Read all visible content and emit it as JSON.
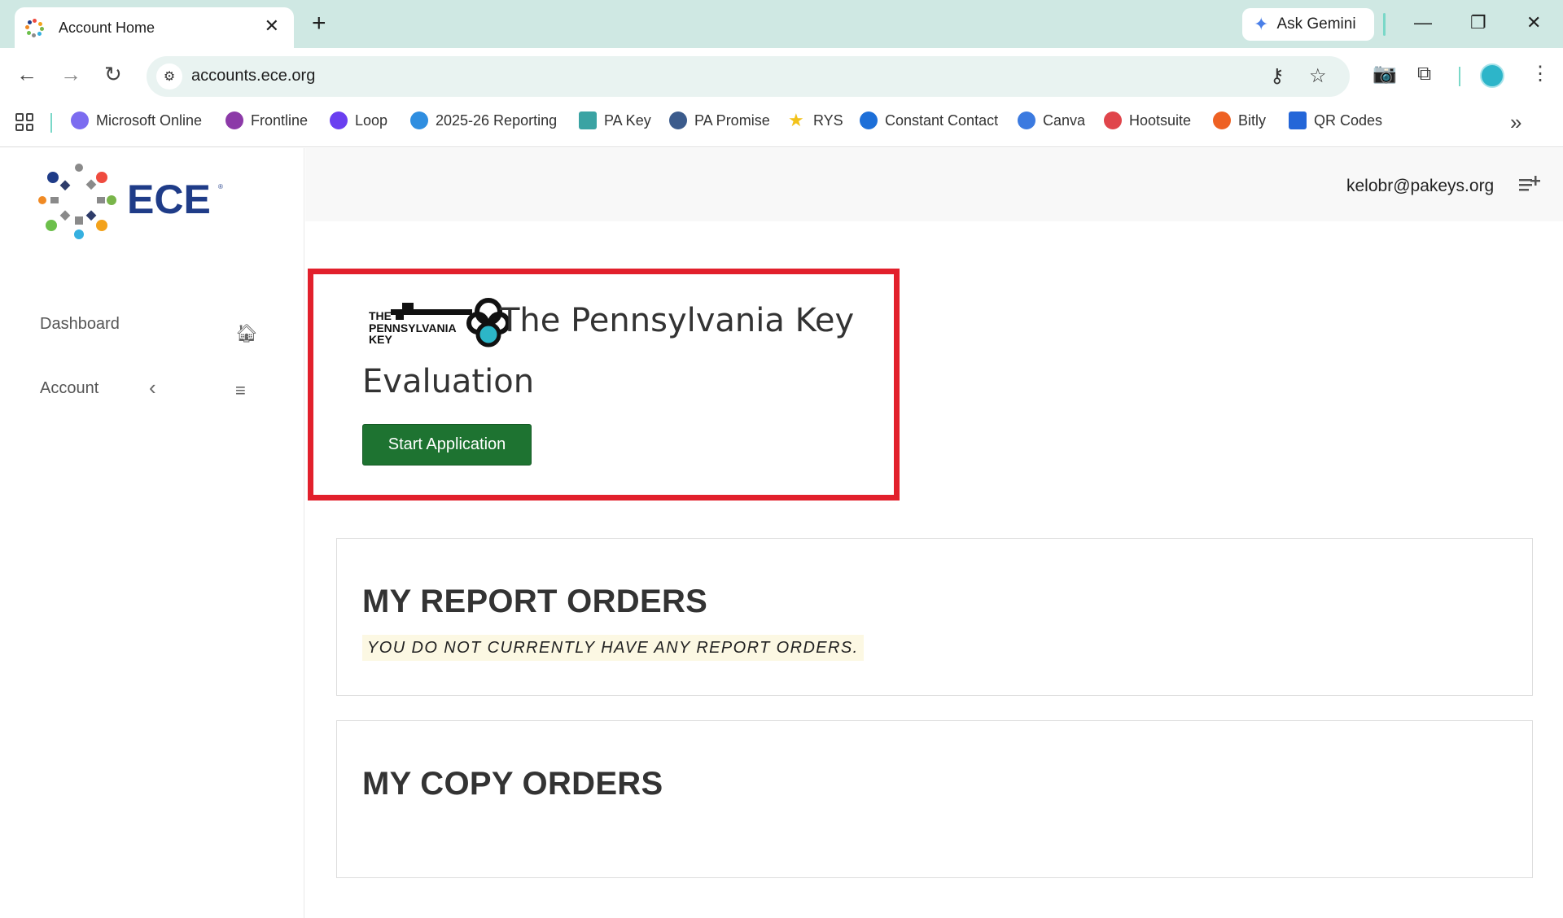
{
  "browser": {
    "tab_title": "Account Home",
    "url": "accounts.ece.org",
    "gemini_label": "Ask Gemini",
    "bookmarks": [
      {
        "label": "Microsoft Online",
        "color": "#7c6cf0"
      },
      {
        "label": "Frontline",
        "color": "#8c3aa8"
      },
      {
        "label": "Loop",
        "color": "#6a3ff0"
      },
      {
        "label": "2025-26 Reporting",
        "color": "#2f8ee0"
      },
      {
        "label": "PA Key",
        "color": "#3aa3a3"
      },
      {
        "label": "PA Promise",
        "color": "#3b5b8c"
      },
      {
        "label": "RYS",
        "color": "#f2c21a"
      },
      {
        "label": "Constant Contact",
        "color": "#1d6fd8"
      },
      {
        "label": "Canva",
        "color": "#3b7ae0"
      },
      {
        "label": "Hootsuite",
        "color": "#e0454b"
      },
      {
        "label": "Bitly",
        "color": "#ee6123"
      },
      {
        "label": "QR Codes",
        "color": "#2466d8"
      }
    ]
  },
  "sidebar": {
    "logo_text": "ECE",
    "items": [
      {
        "label": "Dashboard",
        "icon": "home-icon"
      },
      {
        "label": "Account",
        "icon": "menu-icon"
      }
    ]
  },
  "header": {
    "user_email": "kelobr@pakeys.org"
  },
  "evaluation_card": {
    "logo_text_1": "THE",
    "logo_text_2": "PENNSYLVANIA",
    "logo_text_3": "KEY",
    "title": "The Pennsylvania Key",
    "subtitle": "Evaluation",
    "button_label": "Start Application",
    "highlight_color": "#e2202c",
    "button_color": "#1e7331"
  },
  "report_orders": {
    "title": "MY REPORT ORDERS",
    "notice": "YOU DO NOT CURRENTLY HAVE ANY REPORT ORDERS."
  },
  "copy_orders": {
    "title": "MY COPY ORDERS"
  }
}
